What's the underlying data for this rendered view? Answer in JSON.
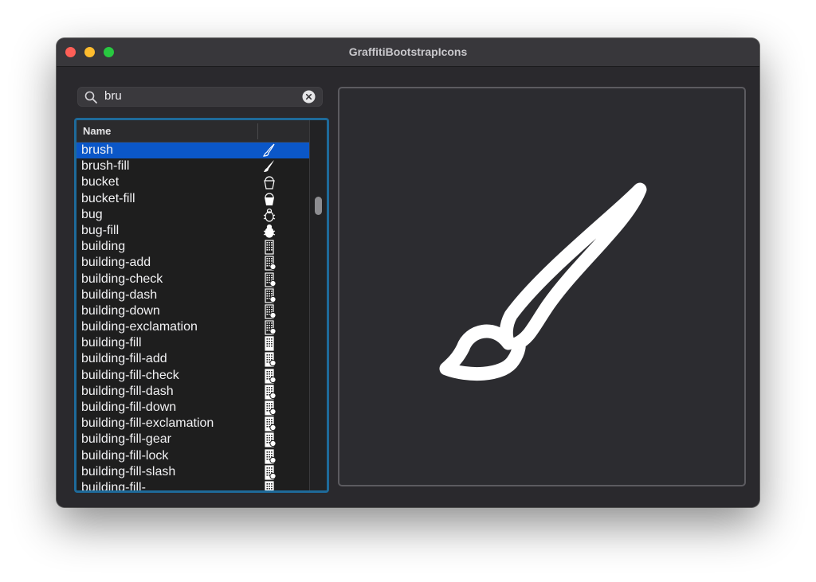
{
  "window": {
    "title": "GraffitiBootstrapIcons"
  },
  "search": {
    "value": "bru",
    "icon": "magnifying-glass",
    "clear_icon": "clear-x-circle"
  },
  "list": {
    "header": "Name",
    "rows": [
      {
        "name": "brush",
        "icon": "brush",
        "selected": true
      },
      {
        "name": "brush-fill",
        "icon": "brush-fill"
      },
      {
        "name": "bucket",
        "icon": "bucket"
      },
      {
        "name": "bucket-fill",
        "icon": "bucket-fill"
      },
      {
        "name": "bug",
        "icon": "bug"
      },
      {
        "name": "bug-fill",
        "icon": "bug-fill"
      },
      {
        "name": "building",
        "icon": "building"
      },
      {
        "name": "building-add",
        "icon": "building-add"
      },
      {
        "name": "building-check",
        "icon": "building-check"
      },
      {
        "name": "building-dash",
        "icon": "building-dash"
      },
      {
        "name": "building-down",
        "icon": "building-down"
      },
      {
        "name": "building-exclamation",
        "icon": "building-exclamation"
      },
      {
        "name": "building-fill",
        "icon": "building-fill"
      },
      {
        "name": "building-fill-add",
        "icon": "building-fill-add"
      },
      {
        "name": "building-fill-check",
        "icon": "building-fill-check"
      },
      {
        "name": "building-fill-dash",
        "icon": "building-fill-dash"
      },
      {
        "name": "building-fill-down",
        "icon": "building-fill-down"
      },
      {
        "name": "building-fill-exclamation",
        "icon": "building-fill-exclamation"
      },
      {
        "name": "building-fill-gear",
        "icon": "building-fill-gear"
      },
      {
        "name": "building-fill-lock",
        "icon": "building-fill-lock"
      },
      {
        "name": "building-fill-slash",
        "icon": "building-fill-slash"
      },
      {
        "name": "building-fill-",
        "icon": "building-fill"
      }
    ]
  },
  "preview": {
    "icon": "brush"
  },
  "colors": {
    "selection": "#0b57c8",
    "focus_ring": "#1e6a9a",
    "window_bg": "#2a292d",
    "traffic_close": "#fe5f57",
    "traffic_min": "#febc2e",
    "traffic_max": "#28c840"
  }
}
